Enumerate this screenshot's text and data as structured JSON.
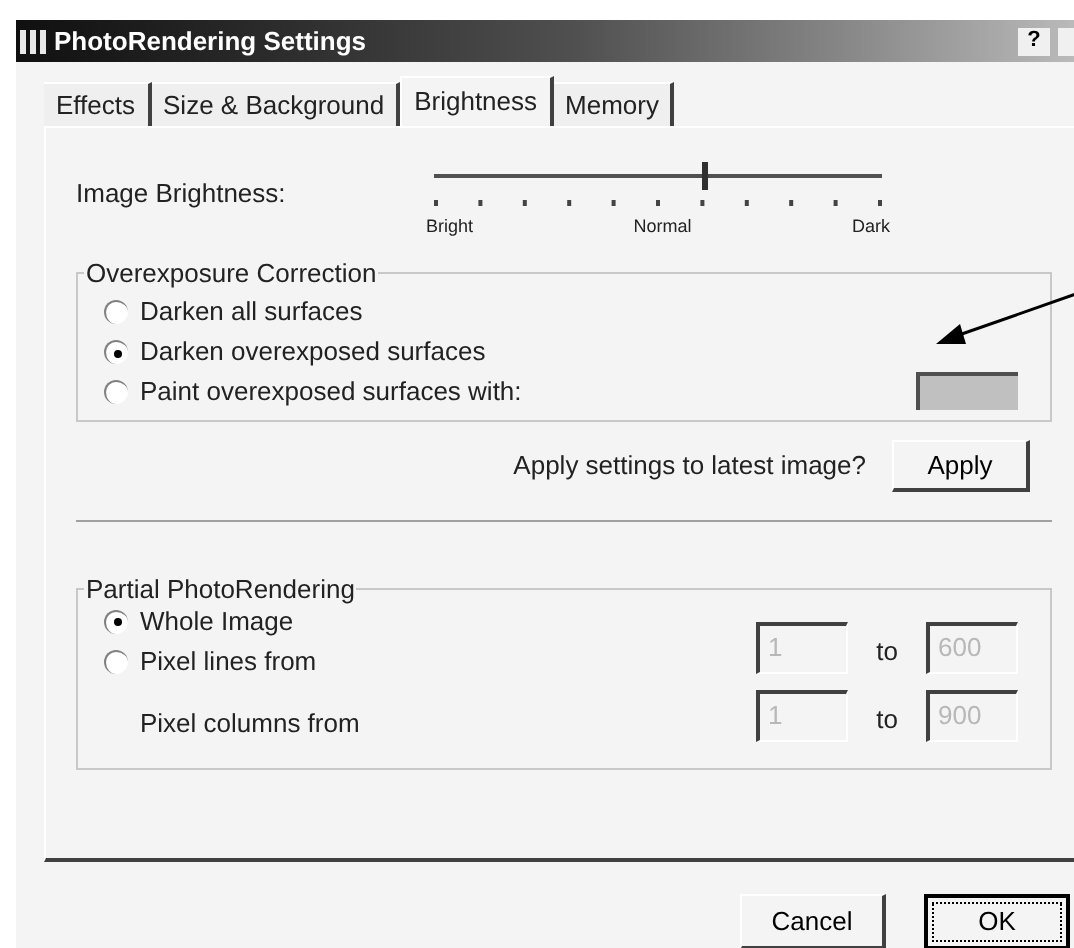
{
  "window": {
    "title": "PhotoRendering Settings",
    "help": "?"
  },
  "tabs": [
    {
      "label": "Effects",
      "selected": false
    },
    {
      "label": "Size & Background",
      "selected": false
    },
    {
      "label": "Brightness",
      "selected": true
    },
    {
      "label": "Memory",
      "selected": false
    }
  ],
  "brightness": {
    "label": "Image Brightness:",
    "level": 0.6,
    "marks": [
      "Bright",
      "Normal",
      "Dark"
    ]
  },
  "overexposure": {
    "title": "Overexposure Correction",
    "options": [
      {
        "label": "Darken all surfaces",
        "selected": false
      },
      {
        "label": "Darken overexposed surfaces",
        "selected": true
      },
      {
        "label": "Paint overexposed surfaces with:",
        "selected": false
      }
    ],
    "swatch": {
      "color": "#c0c0c0"
    }
  },
  "apply": {
    "prompt": "Apply settings to latest image?",
    "button": "Apply"
  },
  "partial": {
    "title": "Partial PhotoRendering",
    "options": [
      {
        "label": "Whole Image",
        "selected": true
      },
      {
        "label": "Pixel lines from",
        "selected": false
      }
    ],
    "ranges": [
      {
        "from": "1",
        "to_label": "to",
        "to": "600",
        "disabled": true
      },
      {
        "label": "Pixel columns from",
        "from": "1",
        "to_label": "to",
        "to": "900",
        "disabled": true
      }
    ]
  },
  "buttons": [
    {
      "label": "Cancel",
      "default": false
    },
    {
      "label": "OK",
      "default": true
    }
  ]
}
